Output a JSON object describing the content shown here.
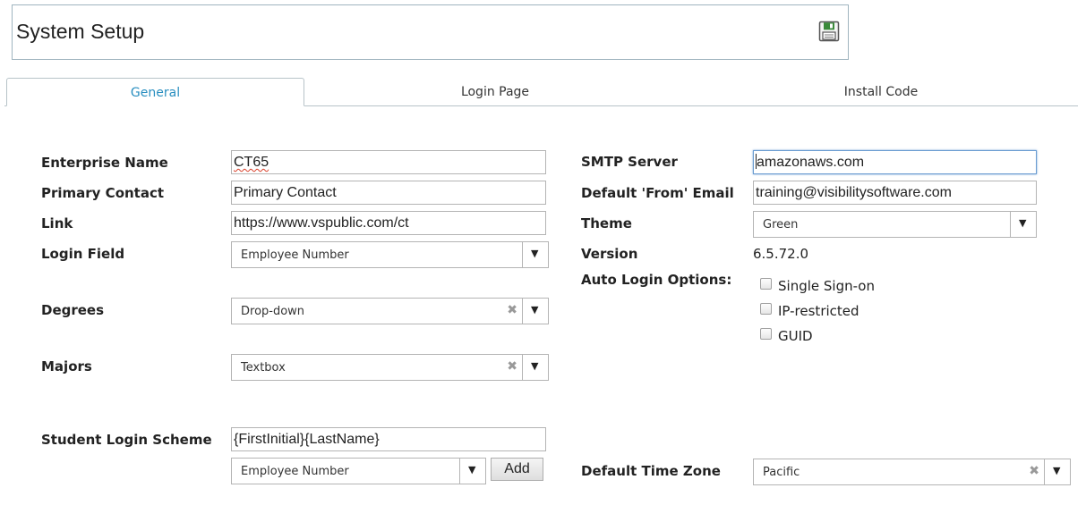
{
  "header": {
    "title": "System Setup"
  },
  "tabs": [
    {
      "label": "General"
    },
    {
      "label": "Login Page"
    },
    {
      "label": "Install Code"
    }
  ],
  "left": {
    "enterprise_name": {
      "label": "Enterprise Name",
      "value": "CT65"
    },
    "primary_contact": {
      "label": "Primary Contact",
      "value": "Primary Contact"
    },
    "link": {
      "label": "Link",
      "value": "https://www.vspublic.com/ct"
    },
    "login_field": {
      "label": "Login Field",
      "value": "Employee Number"
    },
    "degrees": {
      "label": "Degrees",
      "value": "Drop-down"
    },
    "majors": {
      "label": "Majors",
      "value": "Textbox"
    },
    "student_login_scheme": {
      "label": "Student Login Scheme",
      "value": "{FirstInitial}{LastName}",
      "select_value": "Employee Number",
      "add_label": "Add"
    }
  },
  "right": {
    "smtp_server": {
      "label": "SMTP Server",
      "value": "amazonaws.com"
    },
    "default_from_email": {
      "label": "Default 'From' Email",
      "value": "training@visibilitysoftware.com"
    },
    "theme": {
      "label": "Theme",
      "value": "Green"
    },
    "version": {
      "label": "Version",
      "value": "6.5.72.0"
    },
    "auto_login": {
      "label": "Auto Login Options:",
      "options": [
        "Single Sign-on",
        "IP-restricted",
        "GUID"
      ]
    },
    "default_time_zone": {
      "label": "Default Time Zone",
      "value": "Pacific"
    }
  },
  "icons": {
    "save": "floppy-disk-icon",
    "dropdown": "chevron-down-icon",
    "clear": "clear-x-icon"
  },
  "colors": {
    "active_tab": "#2a8fc0",
    "save_icon": "#3a8a3a",
    "spellcheck": "#d9402a"
  }
}
